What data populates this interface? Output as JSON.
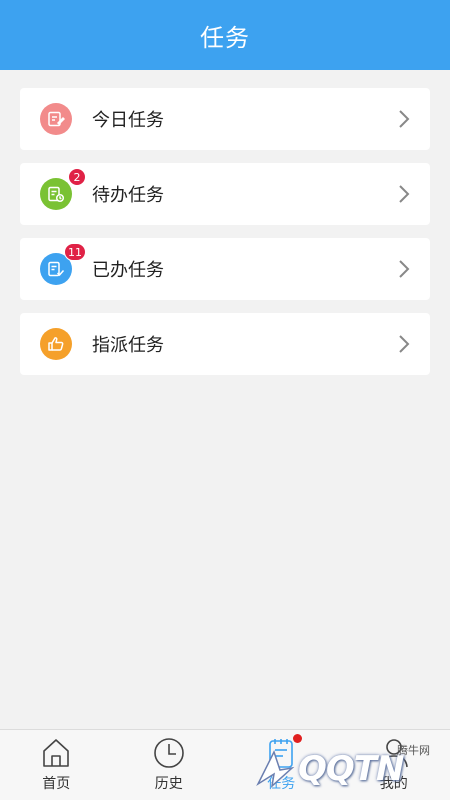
{
  "header": {
    "title": "任务"
  },
  "tasks": [
    {
      "label": "今日任务",
      "icon": "clipboard-edit-icon",
      "color": "#f28b8b",
      "badge": ""
    },
    {
      "label": "待办任务",
      "icon": "clipboard-clock-icon",
      "color": "#7ac233",
      "badge": "2"
    },
    {
      "label": "已办任务",
      "icon": "clipboard-check-icon",
      "color": "#3da2f0",
      "badge": "11"
    },
    {
      "label": "指派任务",
      "icon": "thumbs-up-icon",
      "color": "#f5a02a",
      "badge": ""
    }
  ],
  "tabbar": {
    "items": [
      {
        "label": "首页",
        "icon": "home-icon"
      },
      {
        "label": "历史",
        "icon": "clock-icon"
      },
      {
        "label": "任务",
        "icon": "task-clipboard-icon",
        "active": true
      },
      {
        "label": "我的",
        "icon": "user-icon"
      }
    ]
  },
  "watermark": {
    "text": "QQTN",
    "subtext": "腾牛网"
  },
  "colors": {
    "accent": "#3da2f0",
    "badge": "#e02246"
  }
}
